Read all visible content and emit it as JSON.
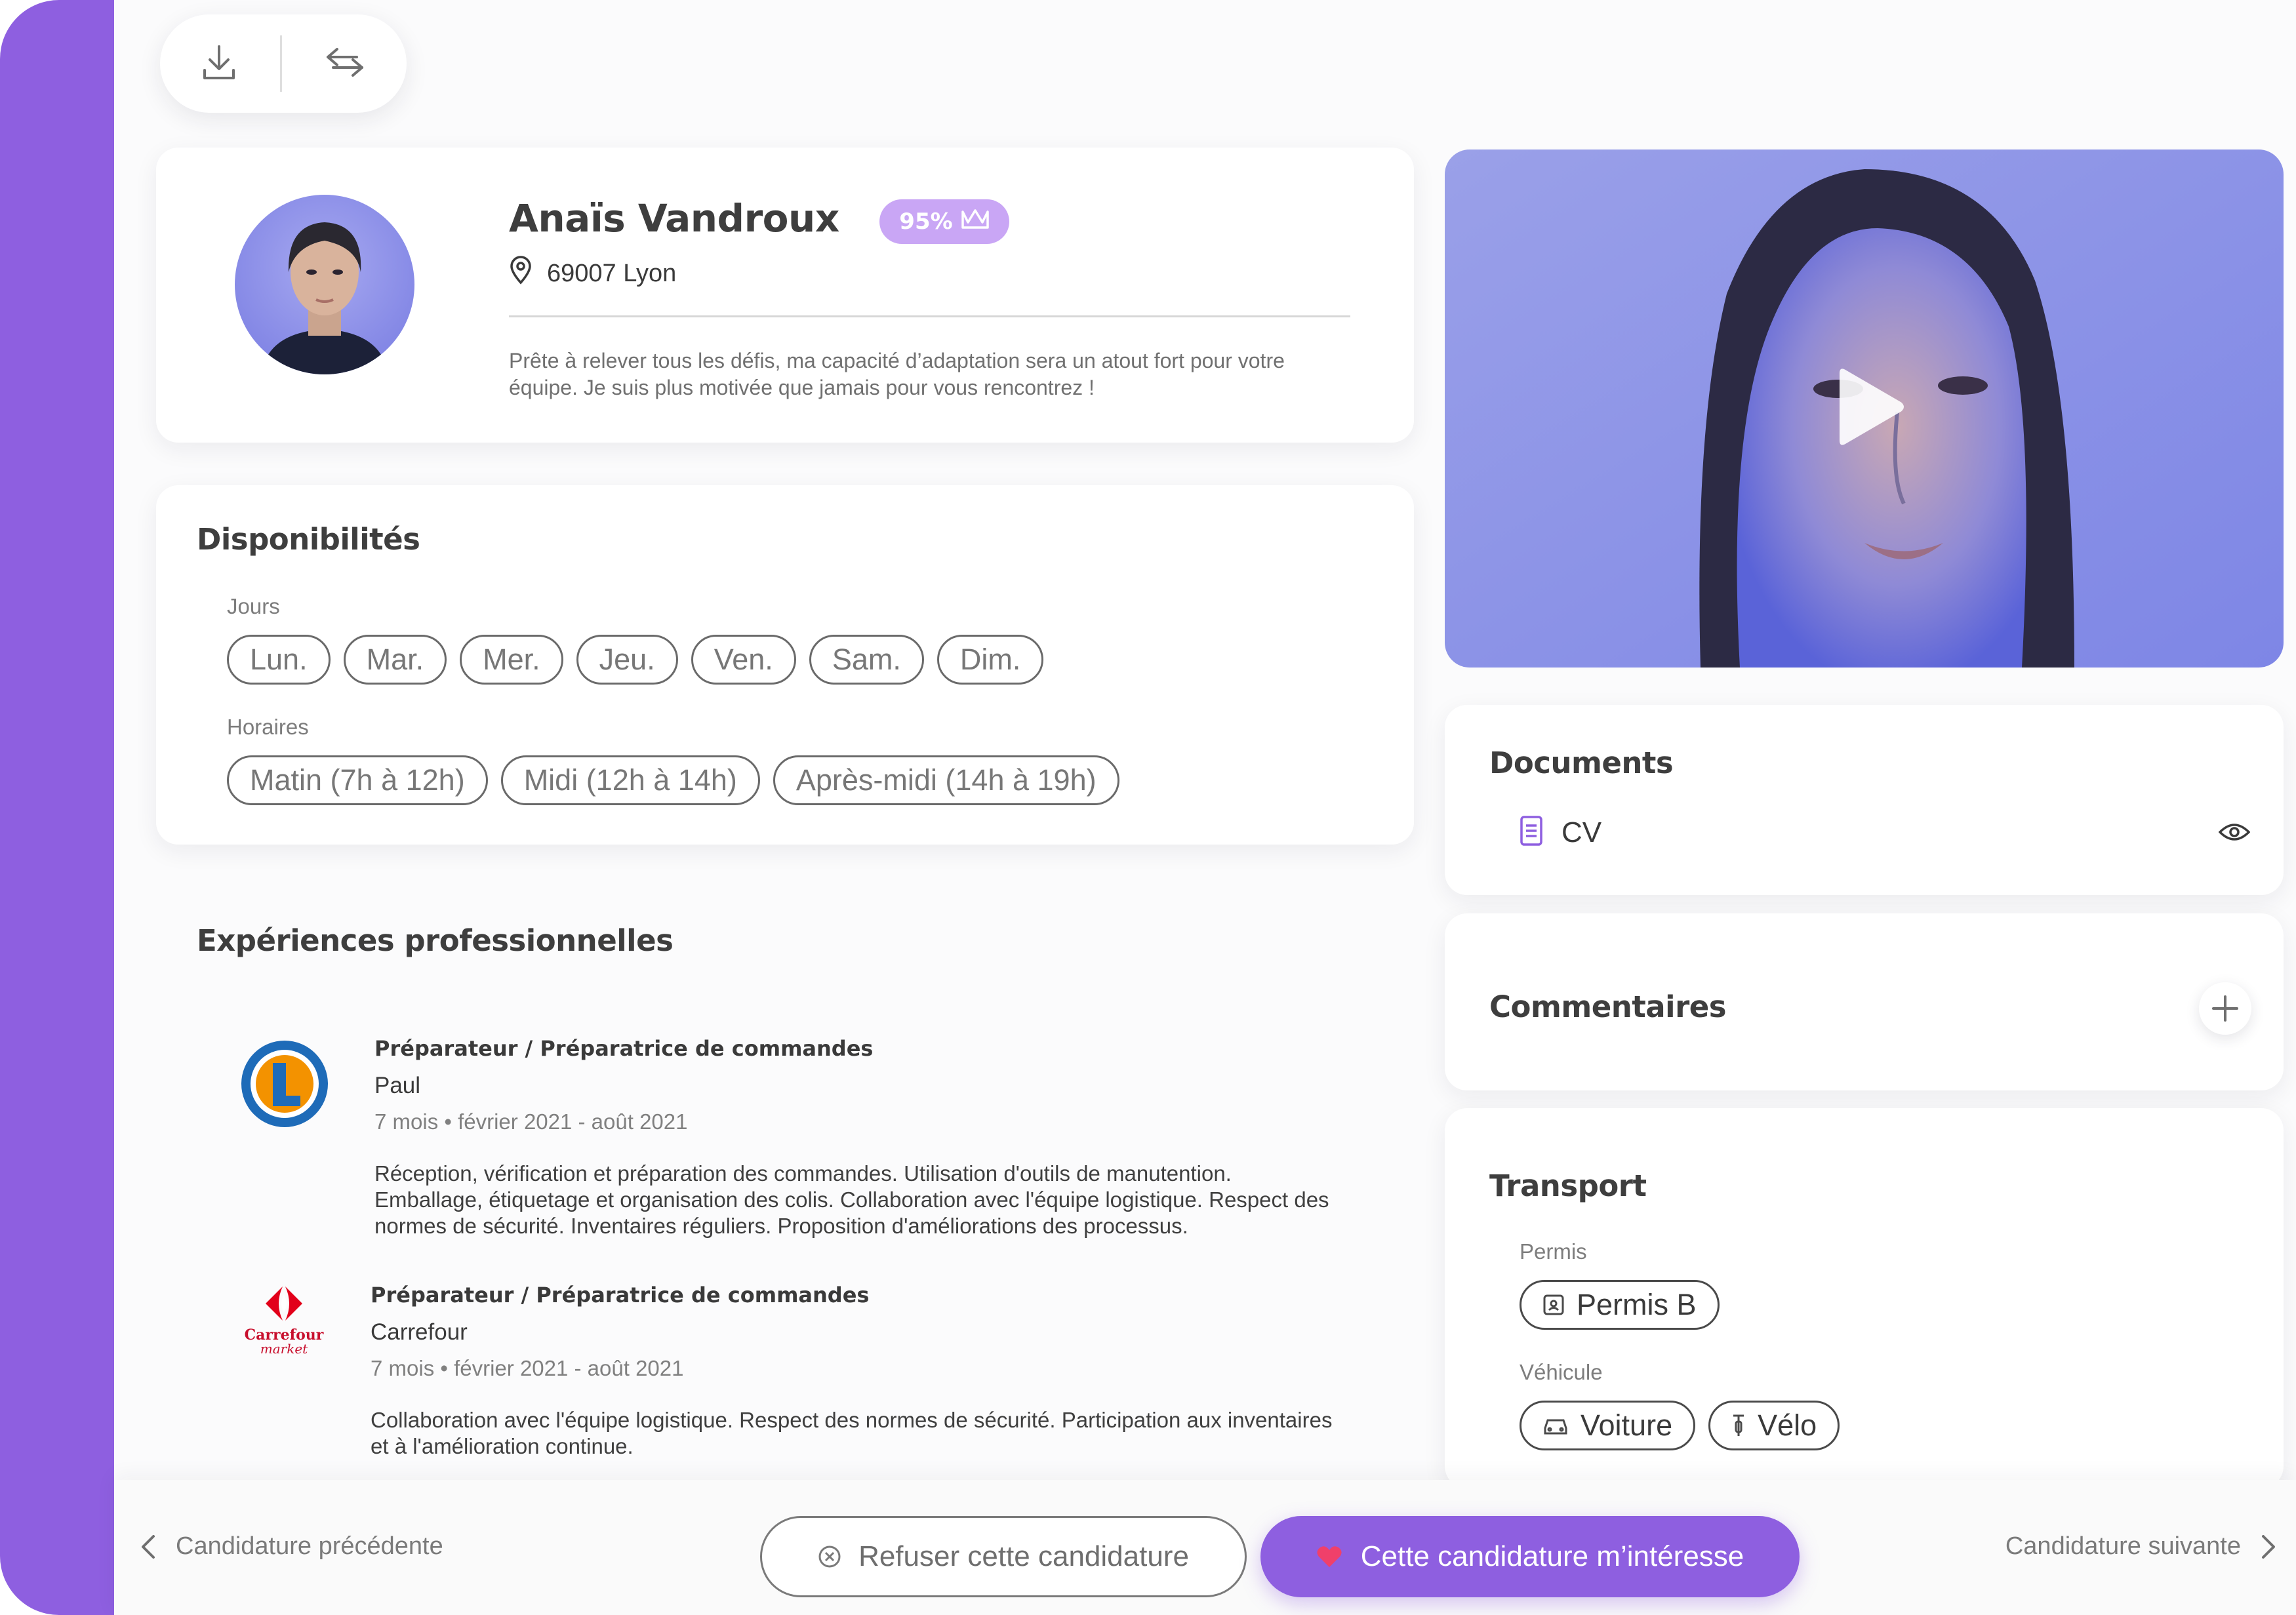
{
  "toolbar": {
    "download_icon": "download-icon",
    "share_icon": "swap-arrows-icon"
  },
  "profile": {
    "name": "Anaïs Vandroux",
    "score": "95%",
    "score_icon": "crown-icon",
    "location": "69007 Lyon",
    "bio_line1": "Prête à relever tous les défis, ma capacité d’adaptation sera un atout fort pour votre",
    "bio_line2": "équipe. Je suis plus motivée que jamais pour vous rencontrez !"
  },
  "availability": {
    "title": "Disponibilités",
    "days_label": "Jours",
    "days": [
      "Lun.",
      "Mar.",
      "Mer.",
      "Jeu.",
      "Ven.",
      "Sam.",
      "Dim."
    ],
    "hours_label": "Horaires",
    "hours": [
      "Matin (7h à 12h)",
      "Midi (12h à 14h)",
      "Après-midi (14h à 19h)"
    ]
  },
  "experiences": {
    "title": "Expériences professionnelles",
    "items": [
      {
        "role": "Préparateur / Préparatrice de commandes",
        "company": "Paul",
        "dates": "7 mois • février 2021 - août 2021",
        "desc_line1": "Réception, vérification et préparation des commandes. Utilisation d'outils de manutention.",
        "desc_line2": "Emballage, étiquetage et organisation des colis. Collaboration avec l'équipe logistique. Respect des",
        "desc_line3": "normes de sécurité. Inventaires réguliers. Proposition d'améliorations des processus."
      },
      {
        "role": "Préparateur / Préparatrice de commandes",
        "company": "Carrefour",
        "dates": "7 mois • février 2021 - août 2021",
        "desc_line1": "Collaboration avec l'équipe logistique. Respect des normes de sécurité. Participation aux inventaires",
        "desc_line2": "et à l'amélioration continue.",
        "logo_line1": "Carrefour",
        "logo_line2": "market"
      }
    ]
  },
  "documents": {
    "title": "Documents",
    "items": [
      {
        "label": "CV"
      }
    ]
  },
  "comments": {
    "title": "Commentaires"
  },
  "transport": {
    "title": "Transport",
    "license_label": "Permis",
    "license": "Permis B",
    "vehicle_label": "Véhicule",
    "vehicles": [
      "Voiture",
      "Vélo"
    ]
  },
  "footer": {
    "prev": "Candidature précédente",
    "refuse": "Refuser cette candidature",
    "accept": "Cette candidature m’intéresse",
    "next": "Candidature suivante"
  },
  "colors": {
    "accent": "#8e5fe0",
    "badge": "#c9a6f5",
    "text": "#3e3e3e",
    "muted": "#7d7d7d"
  }
}
